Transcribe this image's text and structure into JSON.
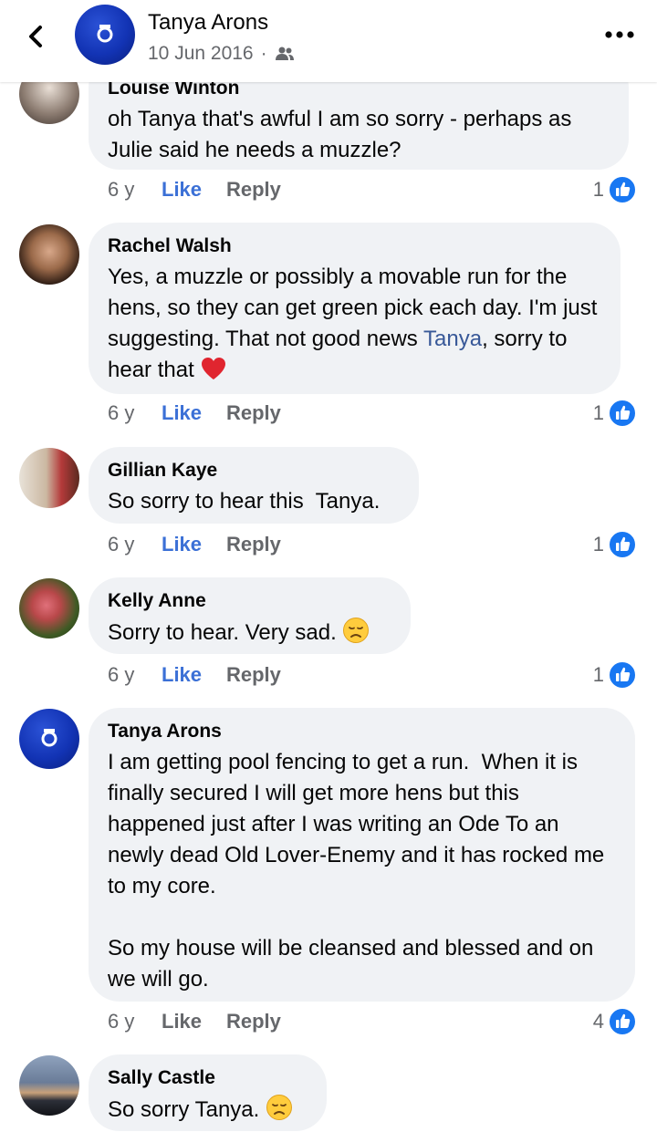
{
  "header": {
    "back_label": "Back",
    "name": "Tanya Arons",
    "date": "10 Jun 2016",
    "separator": "·",
    "audience_icon": "friends-icon",
    "more_icon": "more-icon"
  },
  "comments": [
    {
      "author": "Louise Winton",
      "text": "oh Tanya that's awful I am so sorry - perhaps as Julie said he needs a muzzle?",
      "time": "6 y",
      "like_label": "Like",
      "reply_label": "Reply",
      "reaction_count": "1"
    },
    {
      "author": "Rachel Walsh",
      "text_parts": [
        "Yes, a muzzle or possibly a movable run for the hens, so they can get green pick each day. I'm just suggesting. That not good news ",
        "Tanya",
        ", sorry to hear that "
      ],
      "emoji": "heart",
      "time": "6 y",
      "like_label": "Like",
      "reply_label": "Reply",
      "reaction_count": "1"
    },
    {
      "author": "Gillian Kaye",
      "text": "So sorry to hear this  Tanya.",
      "time": "6 y",
      "like_label": "Like",
      "reply_label": "Reply",
      "reaction_count": "1"
    },
    {
      "author": "Kelly Anne",
      "text": "Sorry to hear. Very sad. ",
      "emoji": "disappointed-face",
      "time": "6 y",
      "like_label": "Like",
      "reply_label": "Reply",
      "reaction_count": "1"
    },
    {
      "author": "Tanya Arons",
      "text": "I am getting pool fencing to get a run.  When it is finally secured I will get more hens but this happened just after I was writing an Ode To an newly dead Old Lover-Enemy and it has rocked me to my core.\n\nSo my house will be cleansed and blessed and on we will go.",
      "time": "6 y",
      "like_label": "Like",
      "reply_label": "Reply",
      "reaction_count": "4"
    },
    {
      "author": "Sally Castle",
      "text": "So sorry Tanya. ",
      "emoji": "disappointed-face"
    }
  ],
  "colors": {
    "like_blue": "#1877f2",
    "bubble_bg": "#f0f2f5",
    "meta_gray": "#65676b",
    "mention": "#385898"
  }
}
